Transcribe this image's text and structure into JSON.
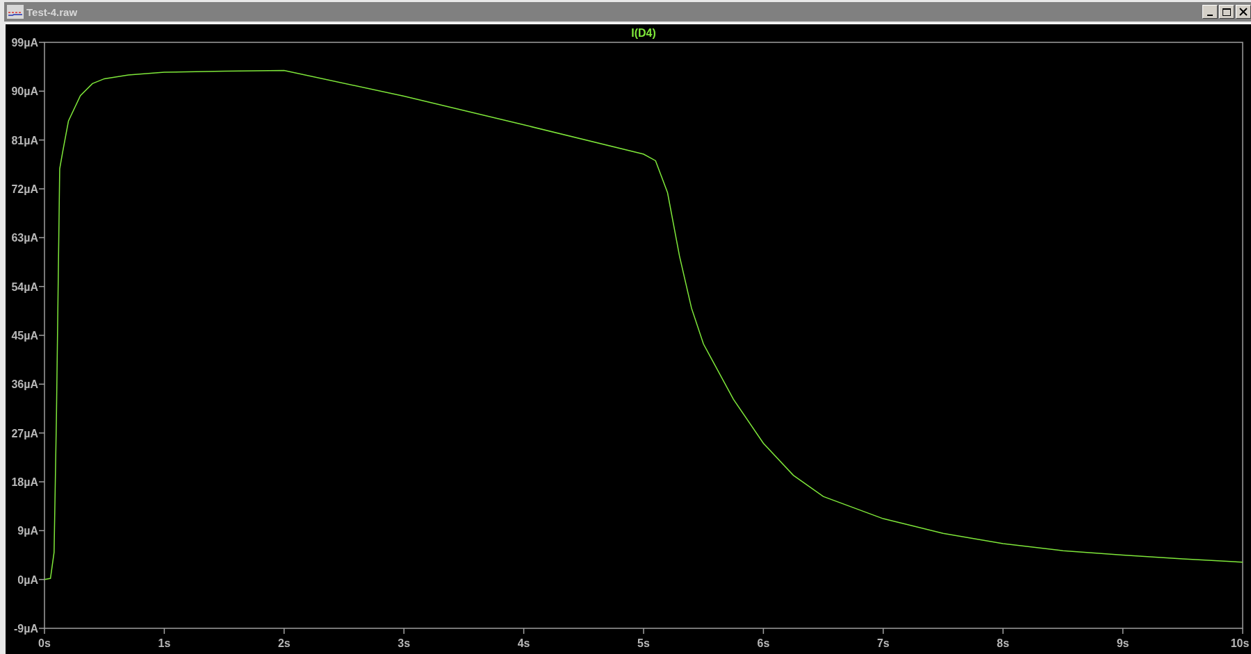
{
  "window": {
    "title": "Test-4.raw"
  },
  "plot": {
    "chart_data": {
      "type": "line",
      "xlim": [
        0,
        10
      ],
      "ylim": [
        -9,
        99
      ],
      "xticks": [
        {
          "value": 0,
          "label": "0s"
        },
        {
          "value": 1,
          "label": "1s"
        },
        {
          "value": 2,
          "label": "2s"
        },
        {
          "value": 3,
          "label": "3s"
        },
        {
          "value": 4,
          "label": "4s"
        },
        {
          "value": 5,
          "label": "5s"
        },
        {
          "value": 6,
          "label": "6s"
        },
        {
          "value": 7,
          "label": "7s"
        },
        {
          "value": 8,
          "label": "8s"
        },
        {
          "value": 9,
          "label": "9s"
        },
        {
          "value": 10,
          "label": "10s"
        }
      ],
      "yticks": [
        {
          "value": -9,
          "label": "-9µA"
        },
        {
          "value": 0,
          "label": "0µA"
        },
        {
          "value": 9,
          "label": "9µA"
        },
        {
          "value": 18,
          "label": "18µA"
        },
        {
          "value": 27,
          "label": "27µA"
        },
        {
          "value": 36,
          "label": "36µA"
        },
        {
          "value": 45,
          "label": "45µA"
        },
        {
          "value": 54,
          "label": "54µA"
        },
        {
          "value": 63,
          "label": "63µA"
        },
        {
          "value": 72,
          "label": "72µA"
        },
        {
          "value": 81,
          "label": "81µA"
        },
        {
          "value": 90,
          "label": "90µA"
        },
        {
          "value": 99,
          "label": "99µA"
        }
      ],
      "x": [
        0,
        0.05,
        0.08,
        0.1,
        0.127,
        0.15,
        0.2,
        0.3,
        0.4,
        0.5,
        0.7,
        1,
        1.5,
        2,
        3,
        4,
        5,
        5.1,
        5.2,
        5.3,
        5.4,
        5.5,
        5.75,
        6,
        6.25,
        6.5,
        7,
        7.5,
        8,
        8.5,
        9,
        9.5,
        10
      ],
      "series": [
        {
          "name": "I(D4)",
          "color": "#7fe83a",
          "values": [
            0,
            0.2,
            5,
            30,
            75.7,
            78.6,
            84.5,
            89.2,
            91.4,
            92.3,
            93,
            93.5,
            93.7,
            93.8,
            89.1,
            83.8,
            78.4,
            77.2,
            71.3,
            59.6,
            50,
            43.4,
            33.2,
            25.1,
            19.2,
            15.3,
            11.2,
            8.5,
            6.6,
            5.3,
            4.5,
            3.8,
            3.2
          ]
        }
      ]
    }
  }
}
